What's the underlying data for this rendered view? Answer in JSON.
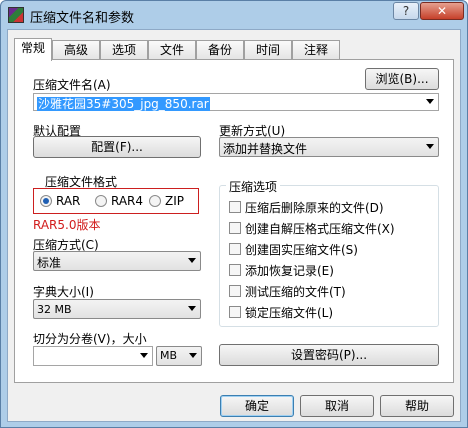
{
  "window": {
    "title": "压缩文件名和参数",
    "help_glyph": "?",
    "close_glyph": "✕"
  },
  "tabs": [
    "常规",
    "高级",
    "选项",
    "文件",
    "备份",
    "时间",
    "注释"
  ],
  "archive_name": {
    "label": "压缩文件名(A)",
    "value": "沙雅花园35#305_jpg_850.rar",
    "browse_label": "浏览(B)..."
  },
  "default_profile": {
    "label": "默认配置",
    "button_label": "配置(F)..."
  },
  "update_mode": {
    "label": "更新方式(U)",
    "value": "添加并替换文件"
  },
  "archive_format": {
    "label": "压缩文件格式",
    "options": [
      "RAR",
      "RAR4",
      "ZIP"
    ],
    "selected": "RAR",
    "note": "RAR5.0版本"
  },
  "compression_method": {
    "label": "压缩方式(C)",
    "value": "标准"
  },
  "dictionary_size": {
    "label": "字典大小(I)",
    "value": "32 MB"
  },
  "split_volumes": {
    "label": "切分为分卷(V)，大小",
    "size_value": "",
    "unit": "MB"
  },
  "archive_options": {
    "label": "压缩选项",
    "items": [
      "压缩后删除原来的文件(D)",
      "创建自解压格式压缩文件(X)",
      "创建固实压缩文件(S)",
      "添加恢复记录(E)",
      "测试压缩的文件(T)",
      "锁定压缩文件(L)"
    ]
  },
  "set_password_label": "设置密码(P)...",
  "buttons": {
    "ok": "确定",
    "cancel": "取消",
    "help": "帮助"
  },
  "colors": {
    "accent": "#3399ff",
    "annotation_red": "#d11c1c"
  }
}
